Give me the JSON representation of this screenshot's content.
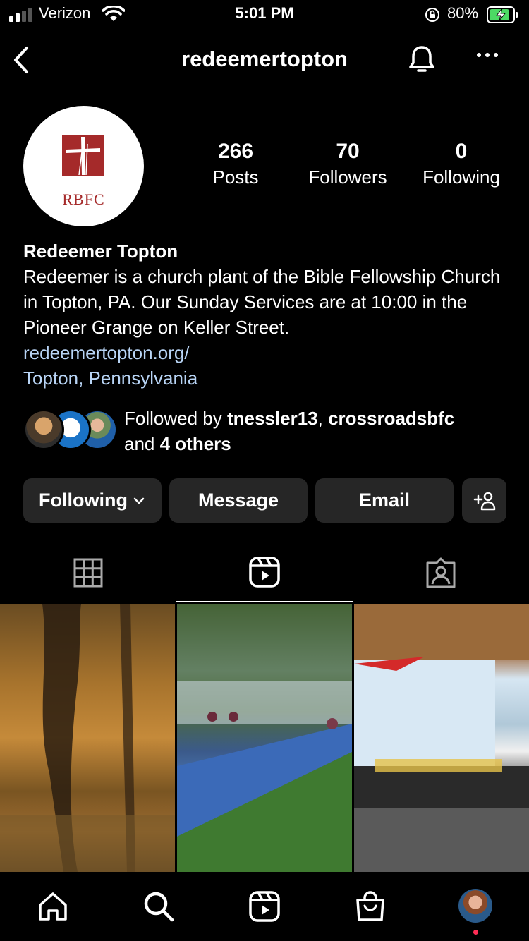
{
  "status_bar": {
    "carrier": "Verizon",
    "time": "5:01 PM",
    "battery_percent": "80%"
  },
  "header": {
    "username": "redeemertopton"
  },
  "profile": {
    "avatar_logo_text": "RBFC",
    "stats": {
      "posts_count": "266",
      "posts_label": "Posts",
      "followers_count": "70",
      "followers_label": "Followers",
      "following_count": "0",
      "following_label": "Following"
    },
    "name": "Redeemer Topton",
    "bio": "Redeemer is a church plant of the Bible Fellowship Church in Topton, PA. Our Sunday Services are at 10:00 in the Pioneer Grange on Keller Street.",
    "link": "redeemertopton.org/",
    "location": "Topton, Pennsylvania",
    "followed_by": {
      "prefix": "Followed by ",
      "user1": "tnessler13",
      "separator": ", ",
      "user2": "crossroadsbfc",
      "and": "and ",
      "others": "4 others"
    }
  },
  "actions": {
    "following_label": "Following",
    "message_label": "Message",
    "email_label": "Email"
  },
  "tabs": {
    "active": "reels",
    "items": [
      "grid-icon",
      "reels-icon",
      "tagged-icon"
    ]
  },
  "bottom_nav": {
    "items": [
      "home-icon",
      "search-icon",
      "reels-icon",
      "shop-icon",
      "profile-avatar"
    ],
    "notification_color": "#ff2d55"
  },
  "colors": {
    "background": "#000000",
    "button_bg": "#262626",
    "link": "#b8d4f5",
    "battery_charging": "#4cd964",
    "logo_red": "#a52a2a"
  }
}
